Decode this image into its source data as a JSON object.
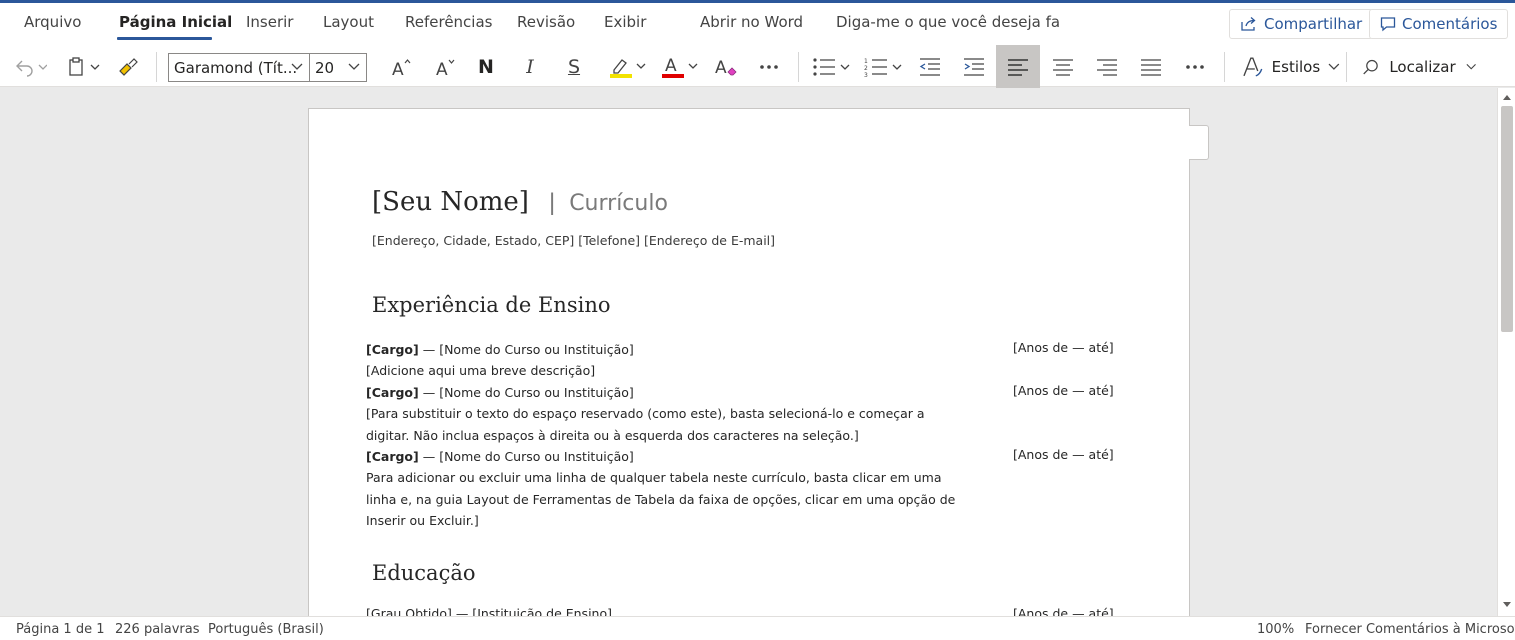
{
  "tabs": {
    "arquivo": "Arquivo",
    "pagina_inicial": "Página Inicial",
    "inserir": "Inserir",
    "layout": "Layout",
    "referencias": "Referências",
    "revisao": "Revisão",
    "exibir": "Exibir",
    "abrir_word": "Abrir no Word",
    "tell_me": "Diga-me o que você deseja fa"
  },
  "top_buttons": {
    "share": "Compartilhar",
    "comments": "Comentários"
  },
  "toolbar": {
    "font_name": "Garamond (Tít...",
    "font_size": "20",
    "bold": "N",
    "italic": "I",
    "strike": "S",
    "styles": "Estilos",
    "find": "Localizar",
    "highlight_color": "#f2e300",
    "font_color": "#e00000",
    "active_alignment": "align-left"
  },
  "document": {
    "name": "[Seu Nome]",
    "separator": "|",
    "subtitle": "Currículo",
    "contact": "[Endereço, Cidade, Estado, CEP]  [Telefone]  [Endereço de E-mail]",
    "section_teaching": "Experiência de Ensino",
    "entries": [
      {
        "role": "[Cargo]",
        "sep": " — ",
        "institution": "[Nome do Curso ou Instituição]",
        "years": "[Anos de — até]",
        "desc": [
          "[Adicione aqui uma breve descrição]"
        ]
      },
      {
        "role": "[Cargo]",
        "sep": " — ",
        "institution": "[Nome do Curso ou Instituição]",
        "years": "[Anos de — até]",
        "desc": [
          "[Para substituir o texto do espaço reservado (como este), basta selecioná-lo e começar a",
          "digitar. Não inclua espaços à direita ou à esquerda dos caracteres na seleção.]"
        ]
      },
      {
        "role": "[Cargo]",
        "sep": " — ",
        "institution": "[Nome do Curso ou Instituição]",
        "years": "[Anos de — até]",
        "desc": [
          "Para adicionar ou excluir uma linha de qualquer tabela neste currículo, basta clicar em uma",
          "linha e, na guia Layout de Ferramentas de Tabela da faixa de opções, clicar em uma opção de",
          "Inserir ou Excluir.]"
        ]
      }
    ],
    "section_education": "Educação",
    "education_partial": {
      "left": "[Grau Obtido] — [Instituição de Ensino]",
      "years": "[Anos de — até]"
    }
  },
  "status": {
    "page": "Página 1 de 1",
    "words": "226 palavras",
    "language": "Português (Brasil)",
    "zoom": "100%",
    "feedback": "Fornecer Comentários à Microsoft"
  }
}
